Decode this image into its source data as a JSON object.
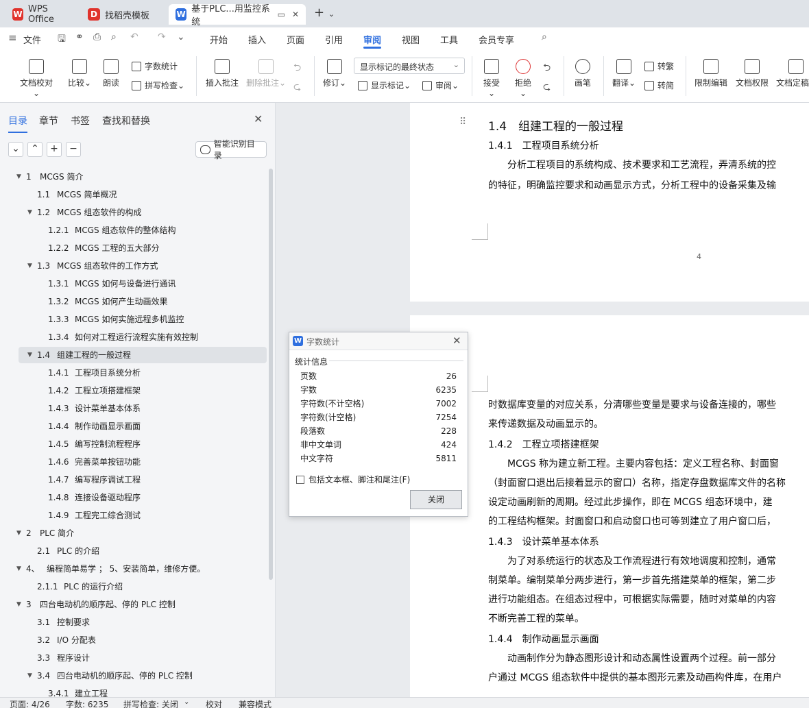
{
  "tabs": [
    {
      "label": "WPS Office",
      "logo": "W",
      "color": "#e0332c"
    },
    {
      "label": "找稻壳模板",
      "logo": "D",
      "color": "#e0332c"
    },
    {
      "label": "基于PLC...用监控系统",
      "logo": "W",
      "color": "#2f6fdf"
    }
  ],
  "menu": {
    "file": "文件",
    "items": [
      "开始",
      "插入",
      "页面",
      "引用",
      "审阅",
      "视图",
      "工具",
      "会员专享"
    ],
    "active": "审阅"
  },
  "ribbon": {
    "doc_check": "文档校对",
    "compare": "比较",
    "read_aloud": "朗读",
    "word_count": "字数统计",
    "spell_check": "拼写检查",
    "insert_comment": "插入批注",
    "delete_comment": "删除批注",
    "track_changes": "修订",
    "markup_state": "显示标记的最终状态",
    "show_markup": "显示标记",
    "review_pane": "审阅",
    "accept": "接受",
    "reject": "拒绝",
    "ink": "画笔",
    "translate": "翻译",
    "to_traditional": "转繁",
    "to_simplified": "转简",
    "restrict_edit": "限制编辑",
    "doc_permission": "文档权限",
    "doc_finalize": "文档定稿"
  },
  "nav": {
    "tabs": [
      "目录",
      "章节",
      "书签",
      "查找和替换"
    ],
    "smart_toc": "智能识别目录"
  },
  "toc": [
    {
      "num": "1",
      "text": "MCGS 简介",
      "level": 0,
      "arrow": true
    },
    {
      "num": "1.1",
      "text": "MCGS 简单概况",
      "level": 1,
      "arrow": false
    },
    {
      "num": "1.2",
      "text": "MCGS 组态软件的构成",
      "level": 1,
      "arrow": true
    },
    {
      "num": "1.2.1",
      "text": "MCGS 组态软件的整体结构",
      "level": 2,
      "arrow": false
    },
    {
      "num": "1.2.2",
      "text": "MCGS 工程的五大部分",
      "level": 2,
      "arrow": false
    },
    {
      "num": "1.3",
      "text": "MCGS 组态软件的工作方式",
      "level": 1,
      "arrow": true
    },
    {
      "num": "1.3.1",
      "text": "MCGS 如何与设备进行通讯",
      "level": 2,
      "arrow": false
    },
    {
      "num": "1.3.2",
      "text": "MCGS 如何产生动画效果",
      "level": 2,
      "arrow": false
    },
    {
      "num": "1.3.3",
      "text": "MCGS 如何实施远程多机监控",
      "level": 2,
      "arrow": false
    },
    {
      "num": "1.3.4",
      "text": "如何对工程运行流程实施有效控制",
      "level": 2,
      "arrow": false
    },
    {
      "num": "1.4",
      "text": "组建工程的一般过程",
      "level": 1,
      "arrow": true,
      "selected": true
    },
    {
      "num": "1.4.1",
      "text": "工程项目系统分析",
      "level": 2,
      "arrow": false
    },
    {
      "num": "1.4.2",
      "text": "工程立项搭建框架",
      "level": 2,
      "arrow": false
    },
    {
      "num": "1.4.3",
      "text": "设计菜单基本体系",
      "level": 2,
      "arrow": false
    },
    {
      "num": "1.4.4",
      "text": "制作动画显示画面",
      "level": 2,
      "arrow": false
    },
    {
      "num": "1.4.5",
      "text": "编写控制流程程序",
      "level": 2,
      "arrow": false
    },
    {
      "num": "1.4.6",
      "text": "完善菜单按钮功能",
      "level": 2,
      "arrow": false
    },
    {
      "num": "1.4.7",
      "text": "编写程序调试工程",
      "level": 2,
      "arrow": false
    },
    {
      "num": "1.4.8",
      "text": "连接设备驱动程序",
      "level": 2,
      "arrow": false
    },
    {
      "num": "1.4.9",
      "text": "工程完工综合测试",
      "level": 2,
      "arrow": false
    },
    {
      "num": "2",
      "text": "PLC 简介",
      "level": 0,
      "arrow": true
    },
    {
      "num": "2.1",
      "text": "PLC 的介绍",
      "level": 1,
      "arrow": false
    },
    {
      "num": "4、",
      "text": "编程简单易学 ；  5、安装简单，维修方便。",
      "level": 0,
      "arrow": true
    },
    {
      "num": "2.1.1",
      "text": "PLC 的运行介绍",
      "level": 1,
      "arrow": false
    },
    {
      "num": "3",
      "text": "四台电动机的顺序起、停的 PLC 控制",
      "level": 0,
      "arrow": true
    },
    {
      "num": "3.1",
      "text": "控制要求",
      "level": 1,
      "arrow": false
    },
    {
      "num": "3.2",
      "text": "I/O 分配表",
      "level": 1,
      "arrow": false
    },
    {
      "num": "3.3",
      "text": "程序设计",
      "level": 1,
      "arrow": false
    },
    {
      "num": "3.4",
      "text": "四台电动机的顺序起、停的 PLC 控制",
      "level": 1,
      "arrow": true
    },
    {
      "num": "3.4.1",
      "text": "建立工程",
      "level": 2,
      "arrow": false
    }
  ],
  "doc": {
    "page1": {
      "heading": "1.4　组建工程的一般过程",
      "sub": "1.4.1　工程项目系统分析",
      "lines": [
        "　　分析工程项目的系统构成、技术要求和工艺流程，弄清系统的控",
        "的特征，明确监控要求和动画显示方式，分析工程中的设备采集及输"
      ],
      "page_number": "4"
    },
    "page2": {
      "lines1": [
        "时数据库变量的对应关系，分清哪些变量是要求与设备连接的，哪些",
        "来传递数据及动画显示的。"
      ],
      "sub2": "1.4.2　工程立项搭建框架",
      "lines2": [
        "　　MCGS 称为建立新工程。主要内容包括：定义工程名称、封面窗",
        "（封面窗口退出后接着显示的窗口）名称，指定存盘数据库文件的名称",
        "设定动画刷新的周期。经过此步操作，即在 MCGS 组态环境中，建",
        "的工程结构框架。封面窗口和启动窗口也可等到建立了用户窗口后，"
      ],
      "sub3": "1.4.3　设计菜单基本体系",
      "lines3": [
        "　　为了对系统运行的状态及工作流程进行有效地调度和控制，通常",
        "制菜单。编制菜单分两步进行，第一步首先搭建菜单的框架，第二步",
        "进行功能组态。在组态过程中，可根据实际需要，随时对菜单的内容",
        "不断完善工程的菜单。"
      ],
      "sub4": "1.4.4　制作动画显示画面",
      "lines4": [
        "　　动画制作分为静态图形设计和动态属性设置两个过程。前一部分",
        "户通过 MCGS 组态软件中提供的基本图形元素及动画构件库，在用户"
      ]
    }
  },
  "dialog": {
    "title": "字数统计",
    "section": "统计信息",
    "stats": [
      {
        "label": "页数",
        "value": "26"
      },
      {
        "label": "字数",
        "value": "6235"
      },
      {
        "label": "字符数(不计空格)",
        "value": "7002"
      },
      {
        "label": "字符数(计空格)",
        "value": "7254"
      },
      {
        "label": "段落数",
        "value": "228"
      },
      {
        "label": "非中文单词",
        "value": "424"
      },
      {
        "label": "中文字符",
        "value": "5811"
      }
    ],
    "checkbox": "包括文本框、脚注和尾注(F)",
    "close": "关闭"
  },
  "status": {
    "page": "页面: 4/26",
    "words": "字数: 6235",
    "spell": "拼写检查: 关闭",
    "proof": "校对",
    "compat": "兼容模式"
  }
}
